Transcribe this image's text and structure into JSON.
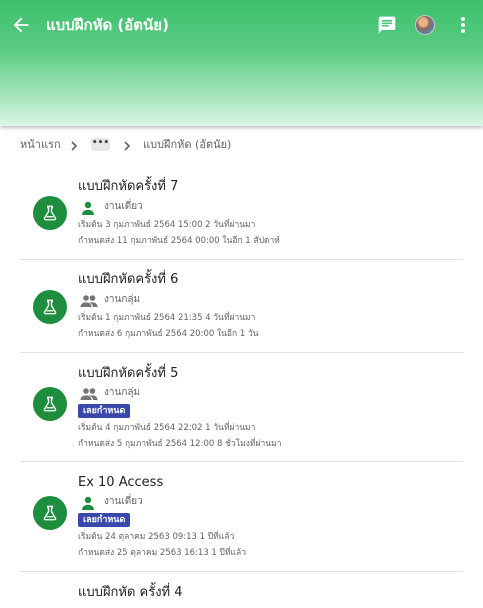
{
  "appbar": {
    "title": "แบบฝึกหัด (อัตนัย)",
    "colors": {
      "green": "#3cbf6d",
      "icon_white": "#ffffff"
    },
    "icons": {
      "back": "arrow-back-icon",
      "chat": "chat-icon",
      "more": "more-vert-icon"
    }
  },
  "breadcrumb": {
    "home": "หน้าแรก",
    "ellipsis": "•••",
    "current": "แบบฝึกหัด (อัตนัย)"
  },
  "assignments": [
    {
      "title": "แบบฝึกหัดครั้งที่ 7",
      "type": "งานเดี่ยว",
      "type_icon": "person-icon",
      "late": false,
      "start": "เริ่มต้น 3 กุมภาพันธ์ 2564 15:00 2 วันที่ผ่านมา",
      "due": "กำหนดส่ง 11 กุมภาพันธ์ 2564 00:00 ในอีก 1 สัปดาห์"
    },
    {
      "title": "แบบฝึกหัดครั้งที่ 6",
      "type": "งานกลุ่ม",
      "type_icon": "group-icon",
      "late": false,
      "start": "เริ่มต้น 1 กุมภาพันธ์ 2564 21:35 4 วันที่ผ่านมา",
      "due": "กำหนดส่ง 6 กุมภาพันธ์ 2564 20:00 ในอีก 1 วัน"
    },
    {
      "title": "แบบฝึกหัดครั้งที่ 5",
      "type": "งานกลุ่ม",
      "type_icon": "group-icon",
      "late": true,
      "late_label": "เลยกำหนด",
      "start": "เริ่มต้น 4 กุมภาพันธ์ 2564 22:02 1 วันที่ผ่านมา",
      "due": "กำหนดส่ง 5 กุมภาพันธ์ 2564 12:00 8 ชั่วโมงที่ผ่านมา"
    },
    {
      "title": "Ex 10 Access",
      "type": "งานเดี่ยว",
      "type_icon": "person-icon",
      "late": true,
      "late_label": "เลยกำหนด",
      "start": "เริ่มต้น 24 ตุลาคม 2563 09:13 1 ปีที่แล้ว",
      "due": "กำหนดส่ง 25 ตุลาคม 2563 16:13 1 ปีที่แล้ว"
    },
    {
      "title": "แบบฝึกหัด ครั้งที่ 4",
      "type": "",
      "type_icon": "",
      "late": false,
      "start": "",
      "due": ""
    }
  ],
  "colors": {
    "badge_blue": "#3949ab",
    "icon_green": "#1e8e3e",
    "muted_text": "#5f6368"
  }
}
